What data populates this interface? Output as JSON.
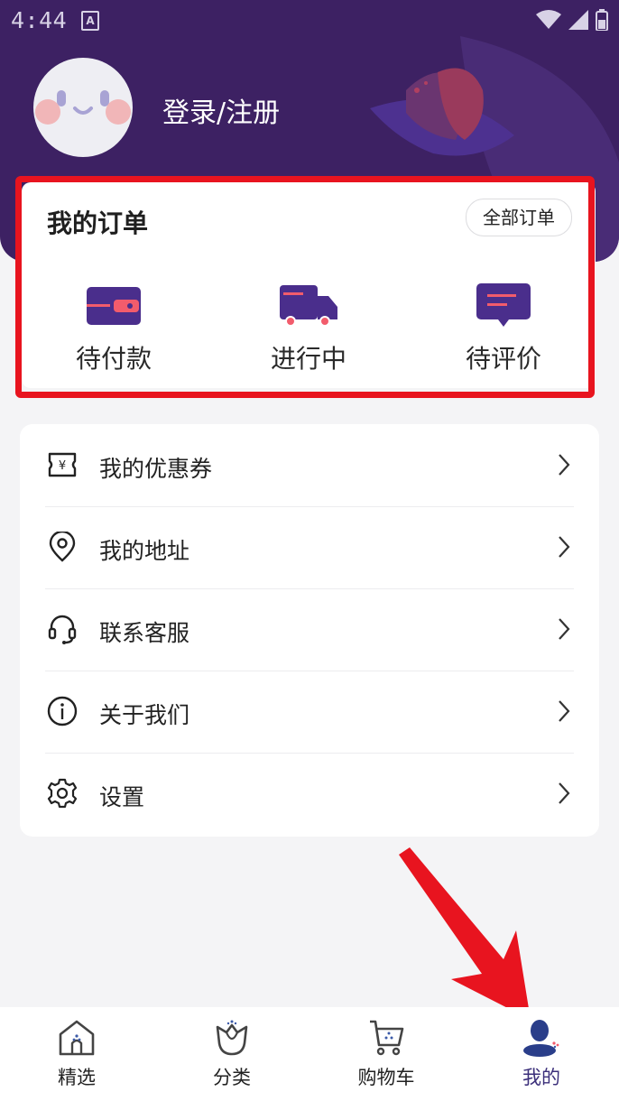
{
  "status_bar": {
    "time": "4:44",
    "badge": "A"
  },
  "profile": {
    "login_label": "登录/注册"
  },
  "orders": {
    "title": "我的订单",
    "all_orders_label": "全部订单",
    "items": [
      {
        "label": "待付款",
        "icon": "wallet-icon"
      },
      {
        "label": "进行中",
        "icon": "truck-icon"
      },
      {
        "label": "待评价",
        "icon": "comment-icon"
      }
    ]
  },
  "menu": {
    "items": [
      {
        "label": "我的优惠券",
        "icon": "coupon-icon"
      },
      {
        "label": "我的地址",
        "icon": "location-pin-icon"
      },
      {
        "label": "联系客服",
        "icon": "headset-icon"
      },
      {
        "label": "关于我们",
        "icon": "info-icon"
      },
      {
        "label": "设置",
        "icon": "gear-icon"
      }
    ]
  },
  "tabbar": {
    "items": [
      {
        "label": "精选",
        "icon": "home-icon"
      },
      {
        "label": "分类",
        "icon": "tulip-icon"
      },
      {
        "label": "购物车",
        "icon": "cart-icon"
      },
      {
        "label": "我的",
        "icon": "user-icon",
        "active": true
      }
    ]
  },
  "colors": {
    "header_bg": "#3d2163",
    "accent": "#4a2e8c",
    "highlight_red": "#e8141f",
    "icon_pink": "#f25c6c"
  }
}
